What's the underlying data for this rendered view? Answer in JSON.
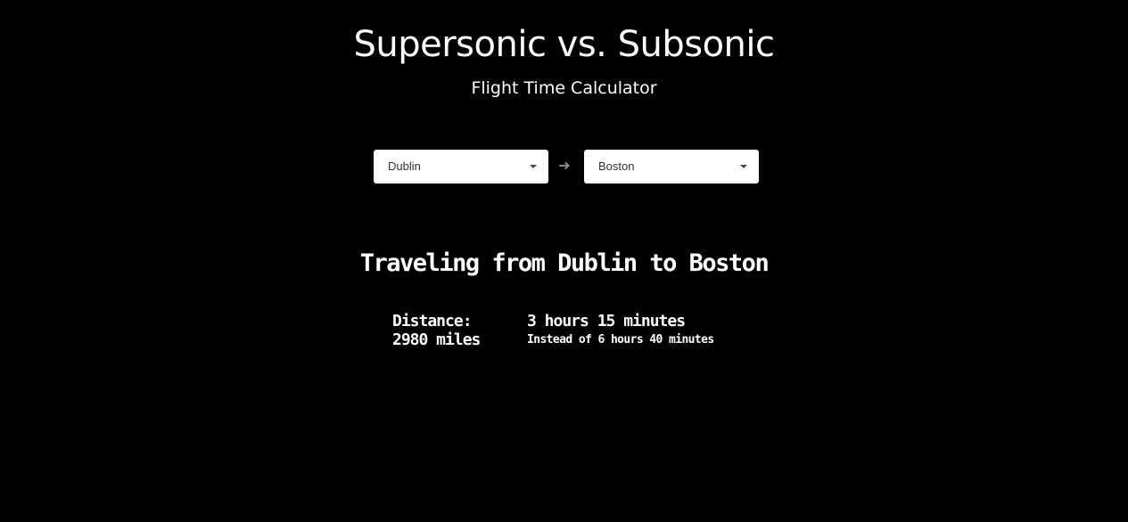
{
  "header": {
    "title": "Supersonic vs. Subsonic",
    "subtitle": "Flight Time Calculator"
  },
  "route": {
    "origin": "Dublin",
    "destination": "Boston",
    "arrow_icon": "arrow-right-icon"
  },
  "result": {
    "heading": "Traveling from Dublin to Boston",
    "distance_label": "Distance:",
    "distance_value": "2980 miles",
    "supersonic_time": "3 hours 15 minutes",
    "subsonic_time": "Instead of 6 hours 40 minutes"
  },
  "colors": {
    "background": "#000000",
    "text": "#ffffff",
    "select_background": "#ffffff",
    "select_text": "#333333",
    "arrow": "#8a8a8a"
  }
}
